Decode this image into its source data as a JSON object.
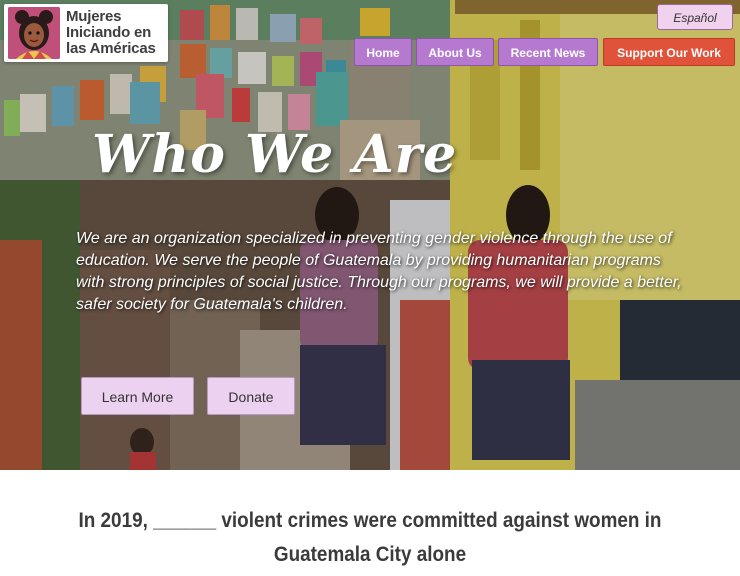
{
  "brand": {
    "name_line1": "Mujeres",
    "name_line2": "Iniciando en",
    "name_line3": "las Américas",
    "logo_icon": "woman-portrait-icon"
  },
  "language": {
    "label": "Español"
  },
  "nav": {
    "items": [
      {
        "label": "Home"
      },
      {
        "label": "About Us"
      },
      {
        "label": "Recent News"
      },
      {
        "label": "Support Our Work"
      }
    ]
  },
  "hero": {
    "title": "Who We Are",
    "description": "We are an organization specialized in preventing gender violence through the use of education. We serve the people of Guatemala by providing humanitarian programs with strong principles of social justice. Through our programs, we will provide a better, safer society for Guatemala's children.",
    "buttons": [
      {
        "label": "Learn More"
      },
      {
        "label": "Donate"
      }
    ]
  },
  "stat": {
    "text": "In 2019, ______ violent crimes were committed against women in Guatemala City alone"
  },
  "colors": {
    "nav_purple": "#b57ad0",
    "nav_red": "#e0533a",
    "button_lavender": "#ecd2f0",
    "logo_pink": "#c0507a"
  }
}
